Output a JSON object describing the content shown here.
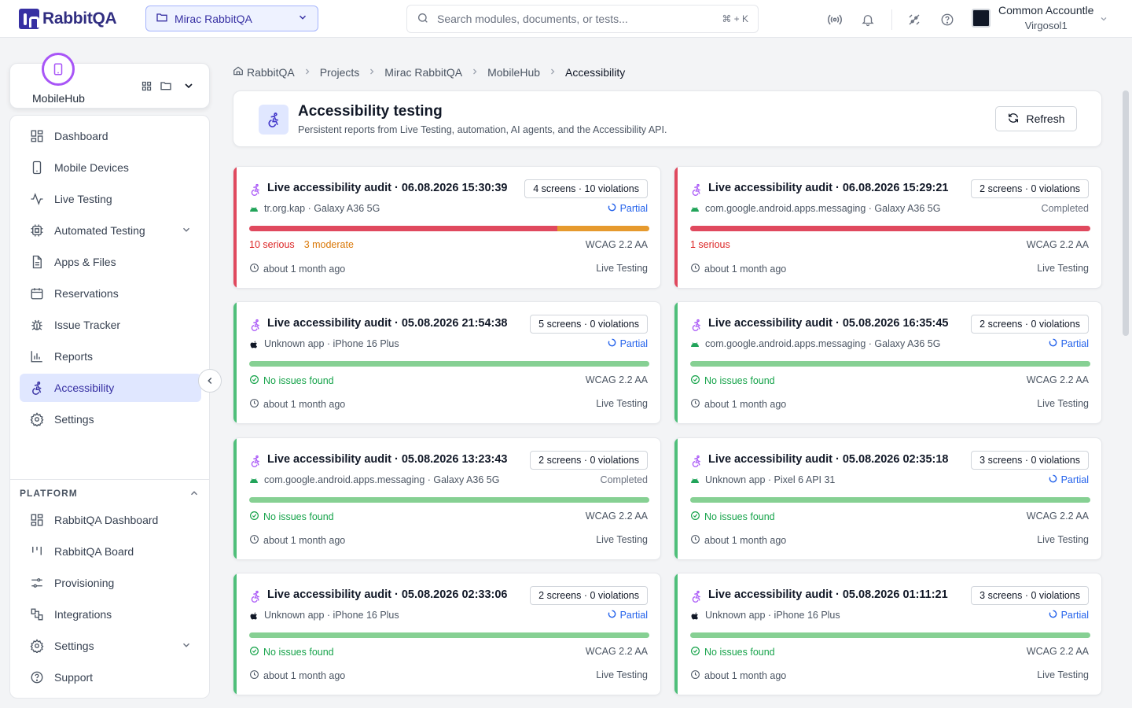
{
  "app": {
    "name": "RabbitQA"
  },
  "project_selector": {
    "label": "Mirac RabbitQA"
  },
  "search": {
    "placeholder": "Search modules, documents, or tests...",
    "shortcut": "⌘ + K"
  },
  "user": {
    "name": "Common Accountle",
    "org": "Virgosol1"
  },
  "hub": {
    "name": "MobileHub"
  },
  "sidebar": {
    "items": [
      {
        "label": "Dashboard",
        "icon": "dashboard-icon",
        "active": false,
        "chevron": false
      },
      {
        "label": "Mobile Devices",
        "icon": "phone-icon",
        "active": false,
        "chevron": false
      },
      {
        "label": "Live Testing",
        "icon": "activity-icon",
        "active": false,
        "chevron": false
      },
      {
        "label": "Automated Testing",
        "icon": "cpu-icon",
        "active": false,
        "chevron": true
      },
      {
        "label": "Apps & Files",
        "icon": "file-icon",
        "active": false,
        "chevron": false
      },
      {
        "label": "Reservations",
        "icon": "calendar-icon",
        "active": false,
        "chevron": false
      },
      {
        "label": "Issue Tracker",
        "icon": "bug-icon",
        "active": false,
        "chevron": false
      },
      {
        "label": "Reports",
        "icon": "bar-chart-icon",
        "active": false,
        "chevron": false
      },
      {
        "label": "Accessibility",
        "icon": "accessibility-icon",
        "active": true,
        "chevron": false
      },
      {
        "label": "Settings",
        "icon": "gear-icon",
        "active": false,
        "chevron": false
      }
    ],
    "platform_title": "PLATFORM",
    "platform_items": [
      {
        "label": "RabbitQA Dashboard",
        "icon": "dashboard-icon",
        "chevron": false
      },
      {
        "label": "RabbitQA Board",
        "icon": "board-icon",
        "chevron": false
      },
      {
        "label": "Provisioning",
        "icon": "sliders-icon",
        "chevron": false
      },
      {
        "label": "Integrations",
        "icon": "integrations-icon",
        "chevron": false
      },
      {
        "label": "Settings",
        "icon": "gear-icon",
        "chevron": true
      },
      {
        "label": "Support",
        "icon": "help-icon",
        "chevron": false
      }
    ]
  },
  "breadcrumb": [
    "RabbitQA",
    "Projects",
    "Mirac RabbitQA",
    "MobileHub",
    "Accessibility"
  ],
  "page": {
    "title": "Accessibility testing",
    "subtitle": "Persistent reports from Live Testing, automation, AI agents, and the Accessibility API.",
    "refresh_label": "Refresh"
  },
  "colors": {
    "serious": "#e0495e",
    "moderate": "#e69a2e",
    "ok": "#86d093",
    "accent_red": "#e0495e",
    "accent_green": "#4fbf7a"
  },
  "audits": [
    {
      "title": "Live accessibility audit · 06.08.2026 15:30:39",
      "badge": "4 screens · 10 violations",
      "platform": "android",
      "meta": "tr.org.kap · Galaxy A36 5G",
      "status": "Partial",
      "status_type": "partial",
      "serious": 10,
      "moderate": 3,
      "serious_label": "10 serious",
      "moderate_label": "3 moderate",
      "ok_label": "",
      "standard": "WCAG 2.2 AA",
      "time": "about 1 month ago",
      "source": "Live Testing"
    },
    {
      "title": "Live accessibility audit · 06.08.2026 15:29:21",
      "badge": "2 screens · 0 violations",
      "platform": "android",
      "meta": "com.google.android.apps.messaging · Galaxy A36 5G",
      "status": "Completed",
      "status_type": "completed",
      "serious": 1,
      "moderate": 0,
      "serious_label": "1 serious",
      "moderate_label": "",
      "ok_label": "",
      "standard": "WCAG 2.2 AA",
      "time": "about 1 month ago",
      "source": "Live Testing"
    },
    {
      "title": "Live accessibility audit · 05.08.2026 21:54:38",
      "badge": "5 screens · 0 violations",
      "platform": "apple",
      "meta": "Unknown app · iPhone 16 Plus",
      "status": "Partial",
      "status_type": "partial",
      "serious": 0,
      "moderate": 0,
      "serious_label": "",
      "moderate_label": "",
      "ok_label": "No issues found",
      "standard": "WCAG 2.2 AA",
      "time": "about 1 month ago",
      "source": "Live Testing"
    },
    {
      "title": "Live accessibility audit · 05.08.2026 16:35:45",
      "badge": "2 screens · 0 violations",
      "platform": "android",
      "meta": "com.google.android.apps.messaging · Galaxy A36 5G",
      "status": "Partial",
      "status_type": "partial",
      "serious": 0,
      "moderate": 0,
      "serious_label": "",
      "moderate_label": "",
      "ok_label": "No issues found",
      "standard": "WCAG 2.2 AA",
      "time": "about 1 month ago",
      "source": "Live Testing"
    },
    {
      "title": "Live accessibility audit · 05.08.2026 13:23:43",
      "badge": "2 screens · 0 violations",
      "platform": "android",
      "meta": "com.google.android.apps.messaging · Galaxy A36 5G",
      "status": "Completed",
      "status_type": "completed",
      "serious": 0,
      "moderate": 0,
      "serious_label": "",
      "moderate_label": "",
      "ok_label": "No issues found",
      "standard": "WCAG 2.2 AA",
      "time": "about 1 month ago",
      "source": "Live Testing"
    },
    {
      "title": "Live accessibility audit · 05.08.2026 02:35:18",
      "badge": "3 screens · 0 violations",
      "platform": "android",
      "meta": "Unknown app · Pixel 6 API 31",
      "status": "Partial",
      "status_type": "partial",
      "serious": 0,
      "moderate": 0,
      "serious_label": "",
      "moderate_label": "",
      "ok_label": "No issues found",
      "standard": "WCAG 2.2 AA",
      "time": "about 1 month ago",
      "source": "Live Testing"
    },
    {
      "title": "Live accessibility audit · 05.08.2026 02:33:06",
      "badge": "2 screens · 0 violations",
      "platform": "apple",
      "meta": "Unknown app · iPhone 16 Plus",
      "status": "Partial",
      "status_type": "partial",
      "serious": 0,
      "moderate": 0,
      "serious_label": "",
      "moderate_label": "",
      "ok_label": "No issues found",
      "standard": "WCAG 2.2 AA",
      "time": "about 1 month ago",
      "source": "Live Testing"
    },
    {
      "title": "Live accessibility audit · 05.08.2026 01:11:21",
      "badge": "3 screens · 0 violations",
      "platform": "apple",
      "meta": "Unknown app · iPhone 16 Plus",
      "status": "Partial",
      "status_type": "partial",
      "serious": 0,
      "moderate": 0,
      "serious_label": "",
      "moderate_label": "",
      "ok_label": "No issues found",
      "standard": "WCAG 2.2 AA",
      "time": "about 1 month ago",
      "source": "Live Testing"
    }
  ]
}
